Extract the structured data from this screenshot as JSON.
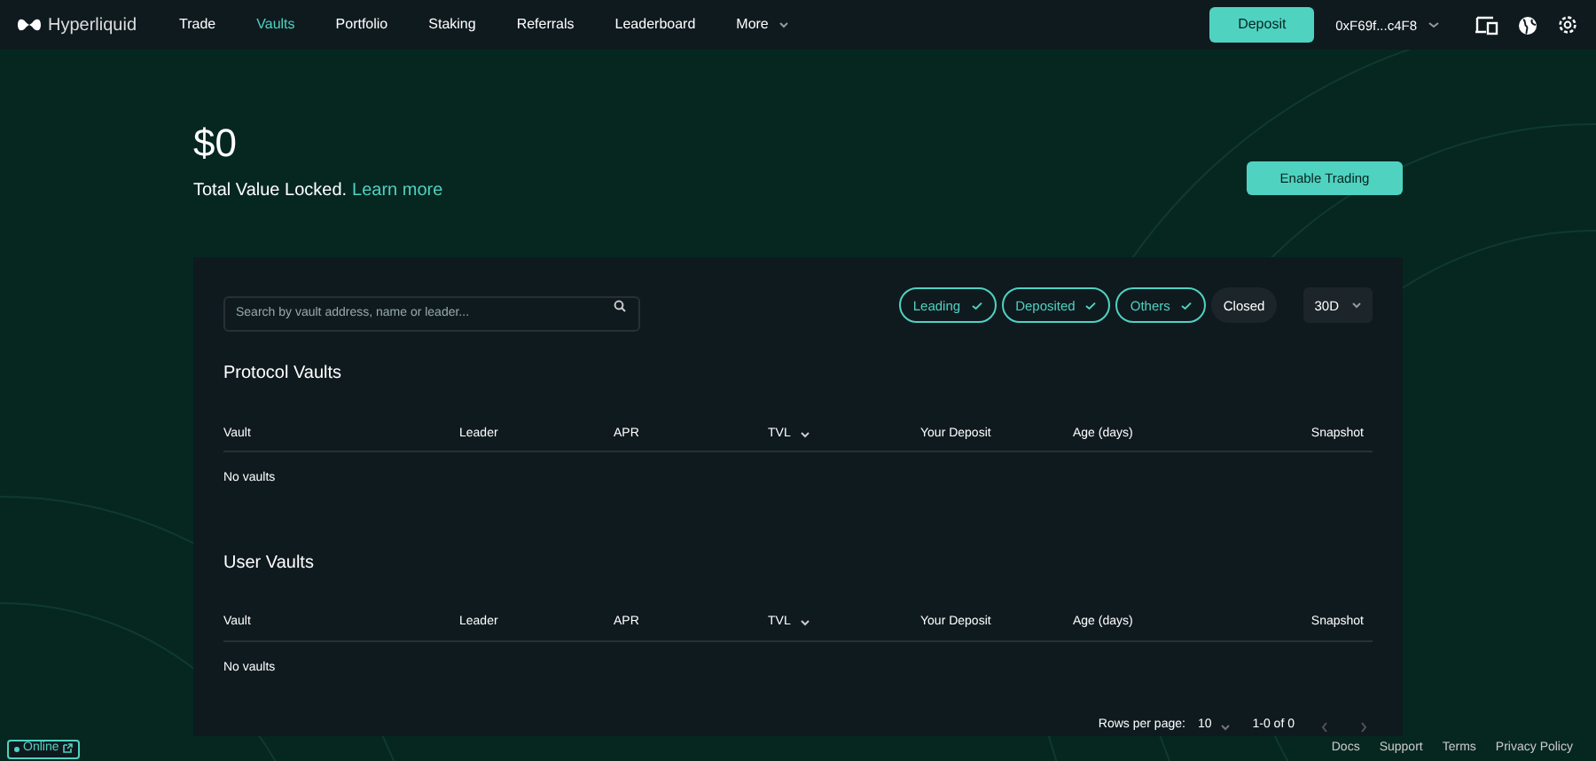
{
  "nav": {
    "logo": "Hyperliquid",
    "items": [
      {
        "label": "Trade",
        "selected": false
      },
      {
        "label": "Vaults",
        "selected": true
      },
      {
        "label": "Portfolio",
        "selected": false
      },
      {
        "label": "Staking",
        "selected": false
      },
      {
        "label": "Referrals",
        "selected": false
      },
      {
        "label": "Leaderboard",
        "selected": false
      },
      {
        "label": "More",
        "selected": false,
        "dropdown": true
      }
    ],
    "deposit": "Deposit",
    "account": "0xF69f...c4F8"
  },
  "tvl": {
    "value": "$0",
    "label": "Total Value Locked.",
    "link": "Learn more"
  },
  "enable_trading": "Enable Trading",
  "search": {
    "placeholder": "Search by vault address, name or leader..."
  },
  "filters": [
    {
      "label": "Leading",
      "selected": true
    },
    {
      "label": "Deposited",
      "selected": true
    },
    {
      "label": "Others",
      "selected": true
    },
    {
      "label": "Closed",
      "selected": false
    }
  ],
  "period": "30D",
  "sections": [
    {
      "title": "Protocol Vaults",
      "columns": [
        {
          "label": "Vault",
          "sorted": false
        },
        {
          "label": "Leader",
          "sorted": false
        },
        {
          "label": "APR",
          "sorted": false
        },
        {
          "label": "TVL",
          "sorted": true
        },
        {
          "label": "Your Deposit",
          "sorted": false
        },
        {
          "label": "Age (days)",
          "sorted": false
        },
        {
          "label": "Snapshot",
          "sorted": false
        }
      ],
      "empty": "No vaults"
    },
    {
      "title": "User Vaults",
      "columns": [
        {
          "label": "Vault",
          "sorted": false
        },
        {
          "label": "Leader",
          "sorted": false
        },
        {
          "label": "APR",
          "sorted": false
        },
        {
          "label": "TVL",
          "sorted": true
        },
        {
          "label": "Your Deposit",
          "sorted": false
        },
        {
          "label": "Age (days)",
          "sorted": false
        },
        {
          "label": "Snapshot",
          "sorted": false
        }
      ],
      "empty": "No vaults"
    }
  ],
  "pagination": {
    "label": "Rows per page:",
    "rows": "10",
    "range": "1-0 of 0"
  },
  "status": "Online",
  "footer_links": [
    "Docs",
    "Support",
    "Terms",
    "Privacy Policy"
  ]
}
